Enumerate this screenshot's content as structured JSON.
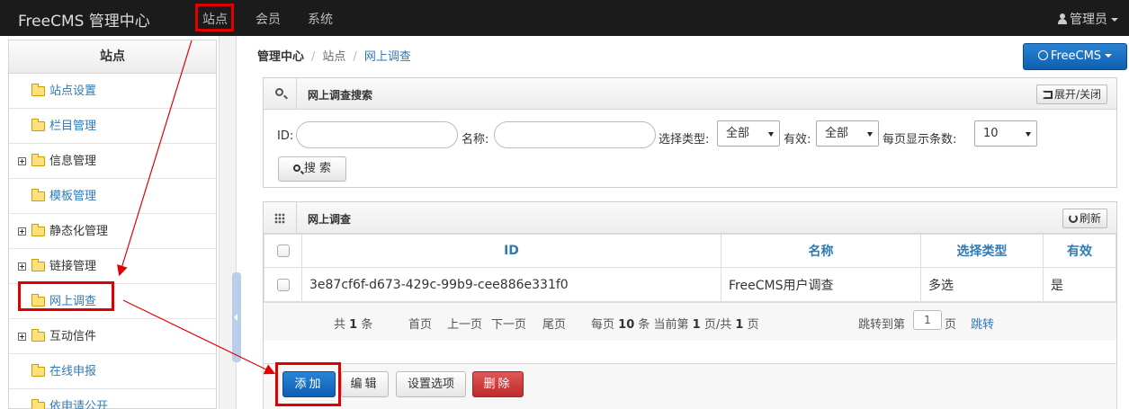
{
  "navbar": {
    "brand": "FreeCMS 管理中心",
    "items": [
      "站点",
      "会员",
      "系统"
    ],
    "admin": "管理员"
  },
  "sidebar": {
    "title": "站点",
    "items": [
      {
        "label": "站点设置",
        "expandable": false
      },
      {
        "label": "栏目管理",
        "expandable": false
      },
      {
        "label": "信息管理",
        "expandable": true
      },
      {
        "label": "模板管理",
        "expandable": false
      },
      {
        "label": "静态化管理",
        "expandable": true
      },
      {
        "label": "链接管理",
        "expandable": true
      },
      {
        "label": "网上调查",
        "expandable": false
      },
      {
        "label": "互动信件",
        "expandable": true
      },
      {
        "label": "在线申报",
        "expandable": false
      },
      {
        "label": "依申请公开",
        "expandable": false
      }
    ]
  },
  "breadcrumb": {
    "home": "管理中心",
    "section": "站点",
    "current": "网上调查"
  },
  "site_button": "FreeCMS",
  "search_panel": {
    "title": "网上调查搜索",
    "toggle_label": "展开/关闭",
    "id_label": "ID:",
    "name_label": "名称:",
    "type_label": "选择类型:",
    "type_value": "全部",
    "valid_label": "有效:",
    "valid_value": "全部",
    "pagesize_label": "每页显示条数:",
    "pagesize_value": "10",
    "search_button": "搜 索"
  },
  "list_panel": {
    "title": "网上调查",
    "refresh_label": "刷新",
    "columns": [
      "ID",
      "名称",
      "选择类型",
      "有效"
    ],
    "rows": [
      {
        "id": "3e87cf6f-d673-429c-99b9-cee886e331f0",
        "name": "FreeCMS用户调查",
        "type": "多选",
        "valid": "是"
      }
    ]
  },
  "pager": {
    "total_prefix": "共",
    "total": "1",
    "total_suffix": "条",
    "first": "首页",
    "prev": "上一页",
    "next": "下一页",
    "last": "尾页",
    "per_page_prefix": "每页",
    "per_page": "10",
    "per_page_mid": "条 当前第",
    "current": "1",
    "page_mid": "页/共",
    "pages": "1",
    "page_suffix": "页",
    "jump_prefix": "跳转到第",
    "jump_value": "1",
    "jump_suffix": "页",
    "jump_button": "跳转"
  },
  "actions": {
    "add": "添加",
    "edit": "编辑",
    "options": "设置选项",
    "delete": "删除"
  },
  "colors": {
    "accent": "#2f7ab5",
    "primary": "#0f5fb0",
    "danger": "#bd2c2c",
    "highlight": "#e00000"
  }
}
